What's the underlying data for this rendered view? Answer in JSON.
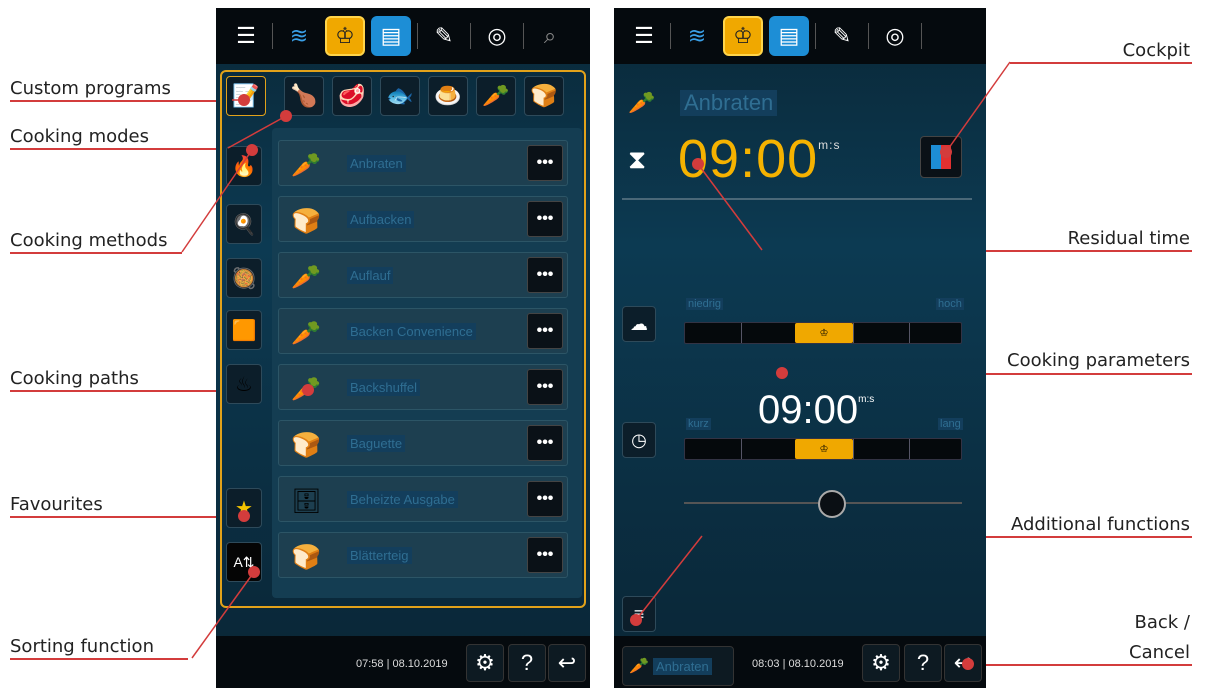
{
  "callouts_left": {
    "custom_programs": "Custom programs",
    "cooking_modes": "Cooking modes",
    "cooking_methods": "Cooking methods",
    "cooking_paths": "Cooking paths",
    "favourites": "Favourites",
    "sorting_function": "Sorting function"
  },
  "callouts_right": {
    "cockpit": "Cockpit",
    "residual_time": "Residual time",
    "cooking_parameters": "Cooking parameters",
    "additional_functions": "Additional functions",
    "back_cancel_line1": "Back /",
    "back_cancel_line2": "Cancel"
  },
  "left_screen": {
    "list": [
      {
        "label": "Anbraten",
        "icon": "vegetables-icon"
      },
      {
        "label": "Aufbacken",
        "icon": "bread-icon"
      },
      {
        "label": "Auflauf",
        "icon": "vegetables-icon"
      },
      {
        "label": "Backen Convenience",
        "icon": "vegetables-icon"
      },
      {
        "label": "Backshuffel",
        "icon": "vegetables-icon"
      },
      {
        "label": "Baguette",
        "icon": "bread-icon"
      },
      {
        "label": "Beheizte Ausgabe",
        "icon": "rack-icon"
      },
      {
        "label": "Blätterteig",
        "icon": "bread-icon"
      }
    ],
    "more_label": "•••",
    "clock_time": "07:58",
    "clock_date": "08.10.2019"
  },
  "right_screen": {
    "title": "Anbraten",
    "residual_time": "09:00",
    "residual_unit": "m:s",
    "humidity_low": "niedrig",
    "humidity_high": "hoch",
    "param_time": "09:00",
    "param_unit": "m:s",
    "time_short": "kurz",
    "time_long": "lang",
    "chip_label": "Anbraten",
    "clock_time": "08:03",
    "clock_date": "08.10.2019"
  },
  "buttons": {
    "settings": "⚙",
    "help": "?",
    "back": "↩"
  },
  "colors": {
    "accent": "#f0a800",
    "callout_line": "#d33c3c",
    "screen_bg": "#0c3a52"
  }
}
